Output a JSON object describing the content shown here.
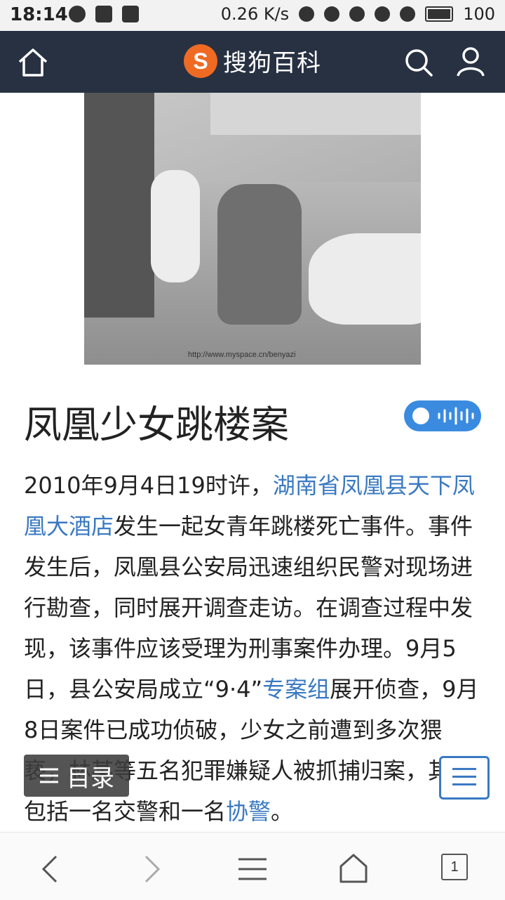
{
  "status_bar": {
    "time": "18:14",
    "network_speed": "0.26 K/s",
    "battery_level": "100",
    "icons": [
      "wechat-icon",
      "gallery-icon",
      "calendar-icon",
      "headset-icon",
      "mute-icon",
      "alarm-icon",
      "wifi-icon",
      "signal-icon",
      "battery-icon"
    ]
  },
  "header": {
    "brand": "搜狗百科",
    "brand_color": "#ef6a23",
    "bg_color": "#273142",
    "icons": [
      "home-icon",
      "search-icon",
      "user-icon"
    ]
  },
  "hero": {
    "watermark": "http://www.myspace.cn/benyazi"
  },
  "article": {
    "title": "凤凰少女跳楼案",
    "segments": [
      {
        "text": "2010年9月4日19时许，",
        "link": false
      },
      {
        "text": "湖南省凤凰县天下凤凰大酒店",
        "link": true
      },
      {
        "text": "发生一起女青年跳楼死亡事件。事件发生后，凤凰县公安局迅速组织民警对现场进行勘查，同时展开调查走访。在调查过程中发现，该事件应该受理为刑事案件办理。9月5日，县公安局成立“9·4”",
        "link": false
      },
      {
        "text": "专案组",
        "link": true
      },
      {
        "text": "展开侦查，9月8日案件已成功侦破，少女之前遭到多次猥亵，林某等五名犯罪嫌疑人被抓捕归案，其中包括一名交警和一名",
        "link": false
      },
      {
        "text": "协警",
        "link": true
      },
      {
        "text": "。",
        "link": false
      }
    ],
    "link_color": "#3a79c2"
  },
  "toc": {
    "label": "目录"
  },
  "bottom_nav": {
    "items": [
      "back-icon",
      "forward-icon",
      "menu-icon",
      "home-icon"
    ],
    "tab_count": "1"
  }
}
